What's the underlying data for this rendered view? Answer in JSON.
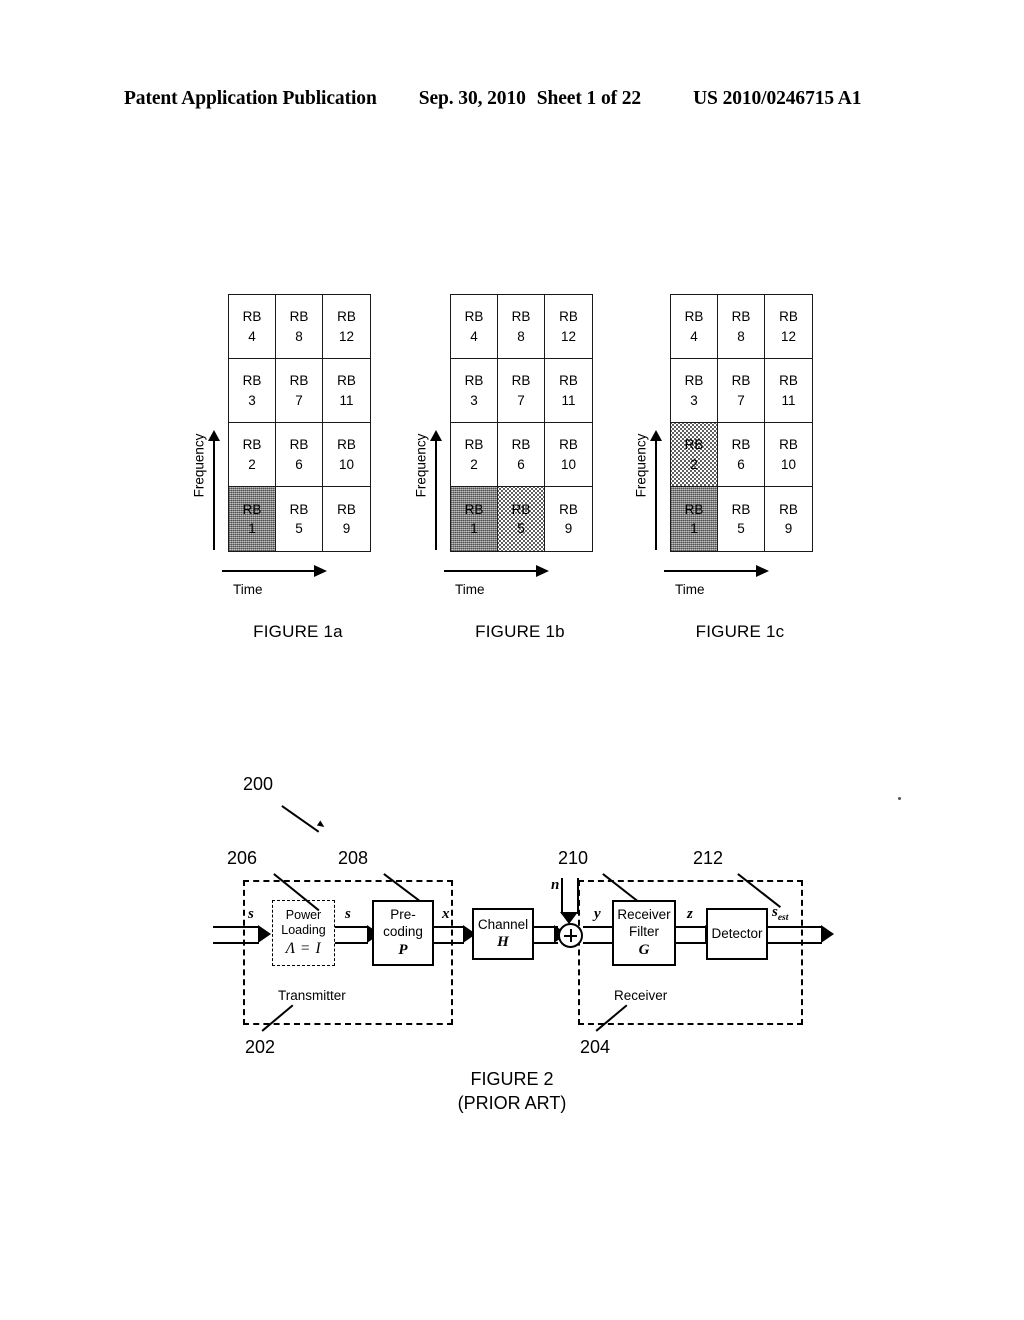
{
  "header": {
    "title": "Patent Application Publication",
    "date": "Sep. 30, 2010",
    "sheet": "Sheet 1 of 22",
    "publication_number": "US 2010/0246715 A1"
  },
  "figures": {
    "fig1": {
      "axis": {
        "y_label": "Frequency",
        "x_label": "Time"
      },
      "grid": {
        "columns": 3,
        "rows": 4,
        "cell_prefix": "RB",
        "row_order_top_to_bottom": [
          [
            "4",
            "8",
            "12"
          ],
          [
            "3",
            "7",
            "11"
          ],
          [
            "2",
            "6",
            "10"
          ],
          [
            "1",
            "5",
            "9"
          ]
        ]
      },
      "panels": [
        {
          "caption": "FIGURE 1a",
          "shaded": {
            "1": "gray"
          }
        },
        {
          "caption": "FIGURE 1b",
          "shaded": {
            "1": "gray",
            "5": "dots"
          }
        },
        {
          "caption": "FIGURE 1c",
          "shaded": {
            "1": "gray",
            "2": "dots"
          }
        }
      ]
    },
    "fig2": {
      "caption_line1": "FIGURE 2",
      "caption_line2": "(PRIOR ART)",
      "refs": {
        "system": "200",
        "transmitter": "202",
        "receiver": "204",
        "power_loading": "206",
        "precoding": "208",
        "receiver_filter": "210",
        "detector": "212"
      },
      "zones": {
        "transmitter_label": "Transmitter",
        "receiver_label": "Receiver"
      },
      "blocks": [
        {
          "name": "power-loading",
          "line1": "Power",
          "line2": "Loading",
          "symbol": "Λ = I"
        },
        {
          "name": "precoding",
          "line1": "Pre-",
          "line2": "coding",
          "symbol": "P"
        },
        {
          "name": "channel",
          "line1": "Channel",
          "line2": "",
          "symbol": "H"
        },
        {
          "name": "receiver-filter",
          "line1": "Receiver",
          "line2": "Filter",
          "symbol": "G"
        },
        {
          "name": "detector",
          "line1": "Detector",
          "line2": "",
          "symbol": ""
        }
      ],
      "signals": {
        "input": "s",
        "after_power_loading": "s",
        "after_precoding": "x",
        "noise": "n",
        "after_noise": "y",
        "after_filter": "z",
        "output": "s",
        "output_sub": "est"
      }
    }
  }
}
